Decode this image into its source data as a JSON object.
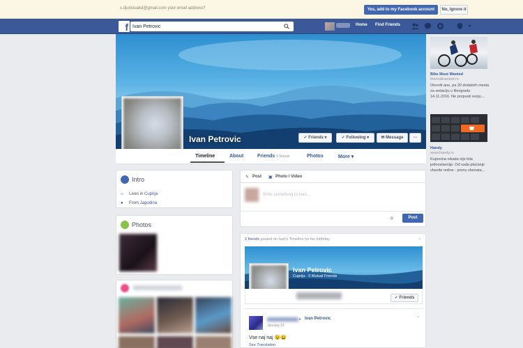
{
  "banner": {
    "message": "s.djurisiuakd@gmail.com your email address?",
    "add_button": "Yes, add to my Facebook account",
    "ignore_button": "No, Ignore it"
  },
  "topnav": {
    "logo": "f",
    "search_value": "Ivan Petrovic",
    "home_label": "Home",
    "find_friends_label": "Find Friends",
    "icons": [
      "friend-requests-icon",
      "messages-icon",
      "notifications-icon",
      "privacy-icon",
      "account-menu-icon"
    ]
  },
  "profile": {
    "name": "Ivan Petrovic",
    "buttons": {
      "friends": "Friends",
      "following": "Following",
      "message": "Message",
      "more": "···"
    },
    "tabs": {
      "timeline": "Timeline",
      "about": "About",
      "friends": "Friends",
      "friends_sub": "5 Mutual",
      "photos": "Photos",
      "more": "More"
    }
  },
  "intro": {
    "title": "Intro",
    "lives_prefix": "Lives in",
    "lives_place": "Cuprija",
    "from_prefix": "From",
    "from_place": "Jagodina"
  },
  "photos": {
    "title": "Photos"
  },
  "composer": {
    "post_tab": "Post",
    "photo_tab": "Photo / Video",
    "placeholder": "Write something to Ivan...",
    "post_button": "Post"
  },
  "feed": {
    "header_prefix": "2 friends",
    "header_verb": "posted",
    "header_suffix": "on Ivan's Timeline for his birthday",
    "card_name": "Ivan Petrovic",
    "card_sub": "Cuprija · 5 Mutual Friends",
    "card_friends_button": "Friends",
    "post_target": "Ivan Petrovic",
    "post_date": "January 15",
    "post_text": "Vse naj naj 😉😀",
    "see_translation": "See Translation"
  },
  "ads": [
    {
      "title": "Bike Must Wanted",
      "url": "thenodivanted.rs",
      "desc": "Otvoriti ane, pa 20 dodatnih mesta za sedaciju u Beogradu 14.11.2016. Ne propusti svoju..."
    },
    {
      "title": "Handy",
      "url": "www.handy.rs",
      "desc": "Kupovina nikada nije bila jednostavnija. Od sada plaćanje vbavite online - pronu zbenata..."
    }
  ],
  "colors": {
    "brand": "#3b5998",
    "button": "#4267b2",
    "link": "#365899",
    "banner_bg": "#fbf7e4",
    "page_bg": "#e9ebee"
  }
}
